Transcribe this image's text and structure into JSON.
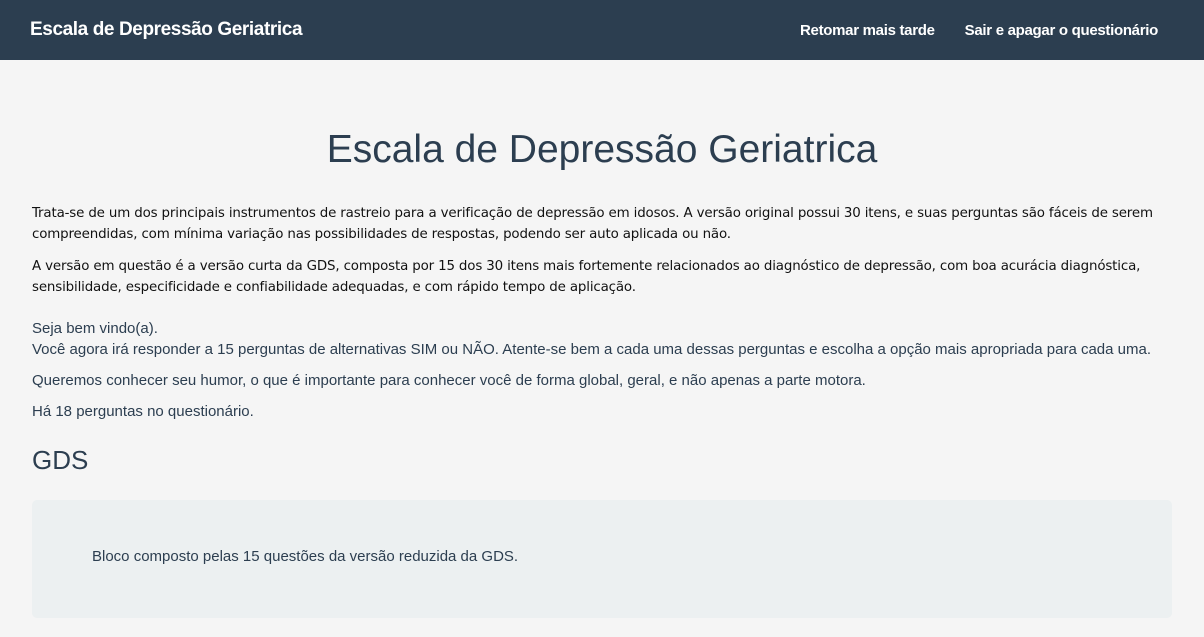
{
  "navbar": {
    "brand": "Escala de Depressão Geriatrica",
    "links": [
      {
        "label": "Retomar mais tarde"
      },
      {
        "label": "Sair e apagar o questionário"
      }
    ]
  },
  "survey": {
    "title": "Escala de Depressão Geriatrica",
    "description": [
      "Trata-se de um dos principais instrumentos de rastreio para a verificação de depressão em idosos. A versão original possui 30 itens, e suas perguntas são fáceis de serem compreendidas, com mínima variação nas possibilidades de respostas, podendo ser auto aplicada ou não.",
      "A versão em questão é a versão curta da GDS, composta por 15 dos 30 itens mais fortemente relacionados ao diagnóstico de depressão, com boa acurácia diagnóstica, sensibilidade, especificidade e confiabilidade adequadas, e com rápido tempo de aplicação."
    ],
    "welcome_line": "Seja bem vindo(a).",
    "welcome_paragraphs": [
      "Você agora irá responder a 15 perguntas de alternativas SIM ou NÃO. Atente-se bem a cada uma dessas perguntas e escolha a opção mais apropriada para cada uma.",
      "Queremos conhecer seu humor, o que é importante para conhecer você de forma global, geral, e não apenas a parte motora."
    ],
    "question_count_text": "Há 18 perguntas no questionário."
  },
  "group": {
    "name": "GDS",
    "description": "Bloco composto pelas 15 questões da versão reduzida da GDS."
  },
  "colors": {
    "navbar_bg": "#2c3e50",
    "page_bg": "#f5f5f5",
    "group_box_bg": "#ecf0f1",
    "text": "#2c3e50"
  }
}
